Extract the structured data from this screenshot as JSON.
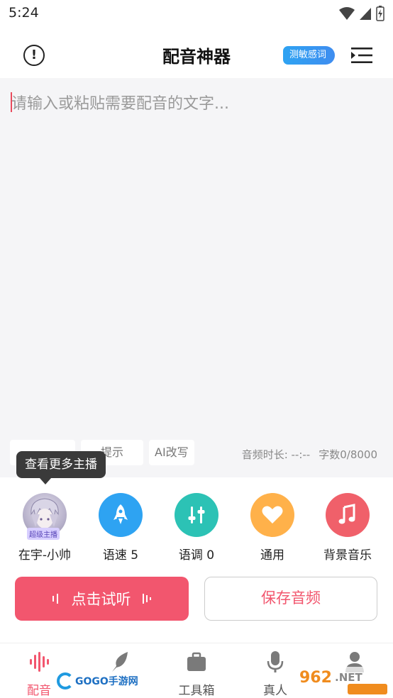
{
  "status_bar": {
    "time": "5:24"
  },
  "header": {
    "title": "配音神器",
    "sensitive_button": "测敏感词"
  },
  "editor": {
    "placeholder": "请输入或粘贴需要配音的文字...",
    "tools": [
      "",
      "",
      "AI改写"
    ],
    "tool_visible_fragment": "提示",
    "audio_duration_label": "音频时长: --:--",
    "char_count": "字数0/8000"
  },
  "tooltip": {
    "text": "查看更多主播"
  },
  "options": {
    "voice": {
      "label": "在宇-小帅",
      "badge": "超级主播"
    },
    "speed": {
      "label": "语速 5"
    },
    "pitch": {
      "label": "语调 0"
    },
    "style": {
      "label": "通用"
    },
    "bgm": {
      "label": "背景音乐"
    }
  },
  "actions": {
    "listen": "点击试听",
    "save": "保存音频"
  },
  "nav": {
    "items": [
      {
        "label": "配音",
        "icon": "waveform-icon",
        "active": true
      },
      {
        "label": "",
        "icon": "feather-icon",
        "active": false
      },
      {
        "label": "工具箱",
        "icon": "briefcase-icon",
        "active": false
      },
      {
        "label": "真人",
        "icon": "microphone-icon",
        "active": false
      },
      {
        "label": "",
        "icon": "person-icon",
        "active": false
      }
    ]
  },
  "watermarks": {
    "left": "GOGO手游网",
    "right": "962.NET 乐游网"
  },
  "colors": {
    "accent": "#f2566e",
    "blue": "#2ea3f2",
    "teal": "#2cc2b5",
    "orange": "#ffb14a",
    "red": "#f0606a"
  }
}
